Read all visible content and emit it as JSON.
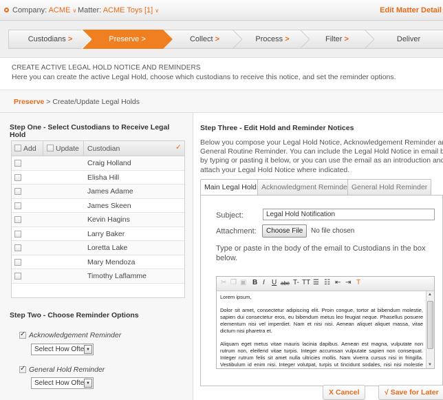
{
  "topbar": {
    "company_label": "Company:",
    "company_value": "ACME",
    "matter_label": "Matter:",
    "matter_value": "ACME Toys [1]",
    "edit_link": "Edit Matter Detail"
  },
  "workflow_steps": [
    {
      "label": "Custodians",
      "arrow": ">"
    },
    {
      "label": "Preserve",
      "arrow": ">"
    },
    {
      "label": "Collect",
      "arrow": ">"
    },
    {
      "label": "Process",
      "arrow": ">"
    },
    {
      "label": "Filter",
      "arrow": ">"
    },
    {
      "label": "Deliver",
      "arrow": ""
    }
  ],
  "intro": {
    "title": "CREATE ACTIVE LEGAL HOLD NOTICE AND REMINDERS",
    "description": "Here you can create the active Legal Hold, choose which custodians to receive this notice, and set the reminder options."
  },
  "breadcrumb": {
    "root": "Preserve",
    "separator": ">",
    "current": "Create/Update Legal Holds"
  },
  "step_one": {
    "title": "Step One - Select Custodians to Receive Legal Hold",
    "columns": {
      "add": "Add",
      "update": "Update",
      "custodian": "Custodian",
      "check": "✓"
    },
    "custodians": [
      "Craig Holland",
      "Elisha Hill",
      "James Adame",
      "James Skeen",
      "Kevin Hagins",
      "Larry Baker",
      "Loretta Lake",
      "Mary Mendoza",
      "Timothy Laflamme"
    ]
  },
  "step_two": {
    "title": "Step Two - Choose Reminder Options",
    "reminders": [
      {
        "label": "Acknowledgement Reminder",
        "checked": true,
        "select": "Select How Often"
      },
      {
        "label": "General Hold Reminder",
        "checked": true,
        "select": "Select How Often"
      }
    ]
  },
  "step_three": {
    "title": "Step Three - Edit Hold and Reminder Notices",
    "description": [
      "Below you compose your Legal Hold Notice, Acknowledgement Reminder and",
      "General Routine Reminder. You can include the Legal Hold Notice in email body",
      "by typing or pasting it below, or you can use the email as an introduction and",
      "attach your Legal Hold Notice where indicated."
    ],
    "tabs": [
      "Main Legal Hold",
      "Acknowledgment Reminder",
      "General Hold Reminder"
    ],
    "subject_label": "Subject:",
    "subject_value": "Legal Hold Notification",
    "attachment_label": "Attachment:",
    "choose_file": "Choose File",
    "no_file": "No file chosen",
    "instructions": "Type or paste in the body of the email to Custodians in the box below.",
    "editor_body": [
      "Lorem ipsum,",
      "Dolor sit amet, consectetur adipiscing elit. Proin congue, tortor at bibendum molestie, sapien dui consectetur eros, eu bibendum metus leo feugiat neque. Phasellus posuere elementum nisi vel imperdiet. Nam et nisi nisi. Aenean aliquet aliquet massa, vitae dictum nisi pharetra et.",
      "Aliquam eget metus vitae mauris lacinia dapibus. Aenean est magna, vulputate non rutrum non, eleifend vitae turpis. Integer accumsan vulputate sapien non consequat. Integer rutrum felis sit amet nulla ultricies mollis. Nam viverra cursus nisi in fringilla. Vestibulum id enim nisi. Integer volutpat, turpis ut tincidunt sodales, nisi nisi molestie enim"
    ]
  },
  "actions": {
    "cancel": "Cancel",
    "cancel_icon": "X",
    "save": "Save for Later",
    "save_icon": "√"
  },
  "colors": {
    "accent": "#f07f22",
    "link": "#e86a1a"
  }
}
